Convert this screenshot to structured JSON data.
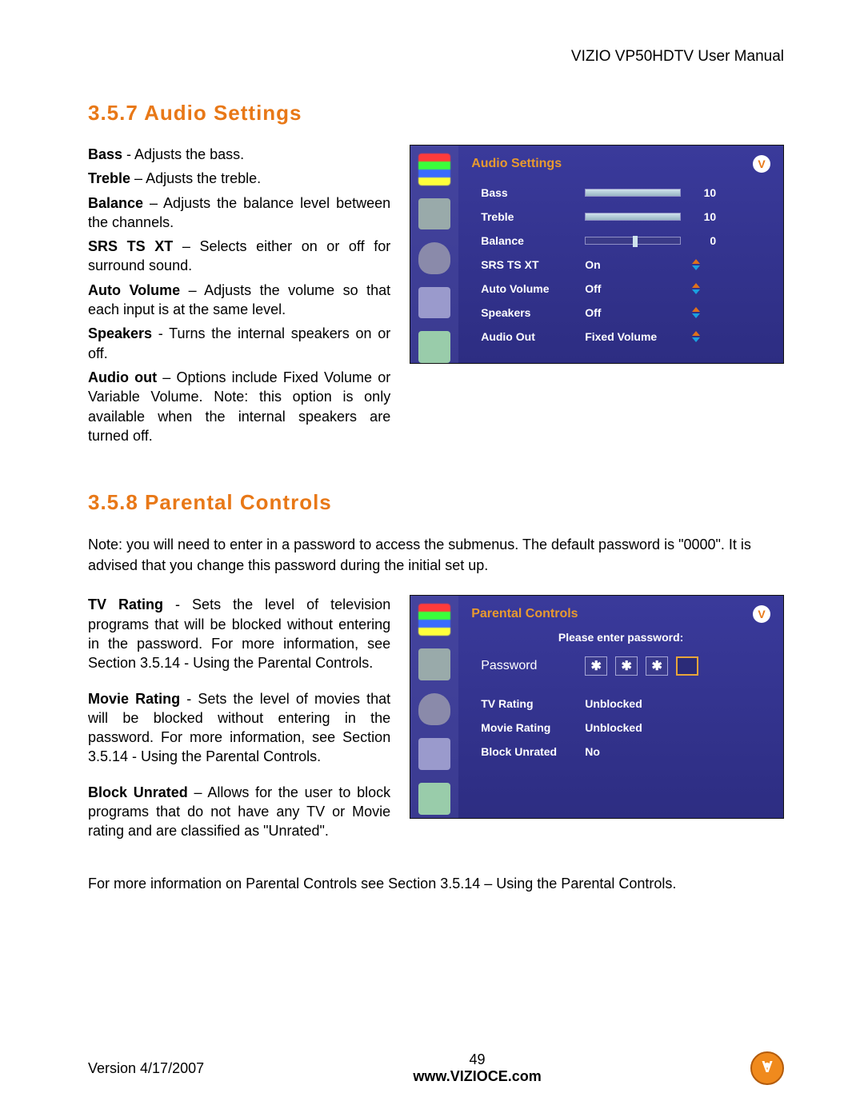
{
  "header": {
    "manual_title": "VIZIO VP50HDTV User Manual"
  },
  "section_audio": {
    "heading": "3.5.7 Audio Settings",
    "items": [
      {
        "term": "Bass",
        "sep": " - ",
        "desc": "Adjusts the bass."
      },
      {
        "term": "Treble",
        "sep": " – ",
        "desc": "Adjusts the treble."
      },
      {
        "term": "Balance",
        "sep": " – ",
        "desc": "Adjusts the balance level between the channels."
      },
      {
        "term": "SRS TS XT",
        "sep": " – ",
        "desc": "Selects either on or off for surround sound."
      },
      {
        "term": "Auto Volume",
        "sep": " – ",
        "desc": "Adjusts the volume so that each input is at the same level."
      },
      {
        "term": "Speakers",
        "sep": " - ",
        "desc": "Turns the internal speakers on or off."
      },
      {
        "term": "Audio out",
        "sep": " – ",
        "desc": "Options include Fixed Volume or Variable Volume.  Note: this option is only available when the internal speakers are turned off."
      }
    ],
    "osd": {
      "title": "Audio Settings",
      "rows": {
        "bass": {
          "label": "Bass",
          "value": "10",
          "fill_percent": 100
        },
        "treble": {
          "label": "Treble",
          "value": "10",
          "fill_percent": 100
        },
        "balance": {
          "label": "Balance",
          "value": "0",
          "knob_percent": 50
        },
        "srs": {
          "label": "SRS TS XT",
          "value": "On"
        },
        "autovol": {
          "label": "Auto Volume",
          "value": "Off"
        },
        "speakers": {
          "label": "Speakers",
          "value": "Off"
        },
        "audioout": {
          "label": "Audio Out",
          "value": "Fixed Volume"
        }
      }
    }
  },
  "section_parental": {
    "heading": "3.5.8 Parental Controls",
    "intro": "Note: you will need to enter in a password to access the submenus.  The default password is \"0000\".  It is advised that you change this password during the initial set up.",
    "items": [
      {
        "term": "TV Rating",
        "sep": " - ",
        "desc": "Sets the level of television programs that will be blocked without entering in the password. For more information, see Section 3.5.14 - Using the Parental Controls."
      },
      {
        "term": "Movie Rating",
        "sep": " - ",
        "desc": "Sets the level of movies that will be blocked without entering in the password. For more information, see Section 3.5.14 - Using the Parental Controls."
      },
      {
        "term": "Block Unrated",
        "sep": " – ",
        "desc": "Allows for the user to block programs that do not have any TV or Movie rating and are classified as \"Unrated\"."
      }
    ],
    "outro": "For more information on Parental Controls see Section 3.5.14 – Using the Parental Controls.",
    "osd": {
      "title": "Parental Controls",
      "prompt": "Please enter password:",
      "password_label": "Password",
      "password_glyph": "✱",
      "rows": {
        "tvrating": {
          "label": "TV Rating",
          "value": "Unblocked"
        },
        "movierating": {
          "label": "Movie Rating",
          "value": "Unblocked"
        },
        "blockunrated": {
          "label": "Block Unrated",
          "value": "No"
        }
      }
    }
  },
  "footer": {
    "version": "Version 4/17/2007",
    "page": "49",
    "url": "www.VIZIOCE.com",
    "logo_letter": "V"
  }
}
